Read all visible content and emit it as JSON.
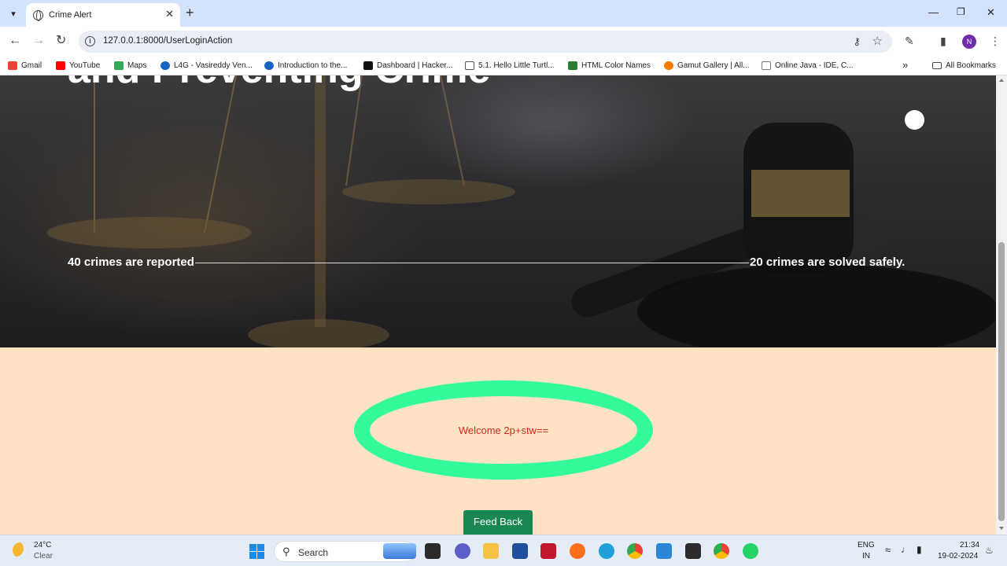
{
  "browser": {
    "tab_title": "Crime Alert",
    "new_tab": "+",
    "url": "127.0.0.1:8000/UserLoginAction",
    "profile_initial": "N",
    "bookmarks": [
      {
        "label": "Gmail",
        "color": "#ea4335"
      },
      {
        "label": "YouTube",
        "color": "#ff0000"
      },
      {
        "label": "Maps",
        "color": "#34a853"
      },
      {
        "label": "L4G - Vasireddy Ven...",
        "color": "#1565c0"
      },
      {
        "label": "Introduction to the...",
        "color": "#1565c0"
      },
      {
        "label": "Dashboard | Hacker...",
        "color": "#111111"
      },
      {
        "label": "5.1. Hello Little Turtl...",
        "color": "#555555"
      },
      {
        "label": "HTML Color Names",
        "color": "#2e7d32"
      },
      {
        "label": "Gamut Gallery | All...",
        "color": "#f57c00"
      },
      {
        "label": "Online Java - IDE, C...",
        "color": "#777777"
      }
    ],
    "more_bookmarks": "»",
    "all_bookmarks": "All Bookmarks"
  },
  "hero": {
    "title": "and Preventing Crime",
    "crimes_reported": "40  crimes are reported",
    "crimes_solved": "20 crimes are solved safely."
  },
  "main": {
    "welcome": "Welcome 2p+stw==",
    "feedback_button": "Feed Back"
  },
  "taskbar": {
    "temperature": "24°C",
    "condition": "Clear",
    "search_label": "Search",
    "language_top": "ENG",
    "language_bottom": "IN",
    "time": "21:34",
    "date": "19-02-2024"
  },
  "colors": {
    "accent_green": "#33fb9b",
    "feedback_bg": "#198754",
    "page_bg": "#fde3c3",
    "welcome_text": "#d1281e"
  }
}
